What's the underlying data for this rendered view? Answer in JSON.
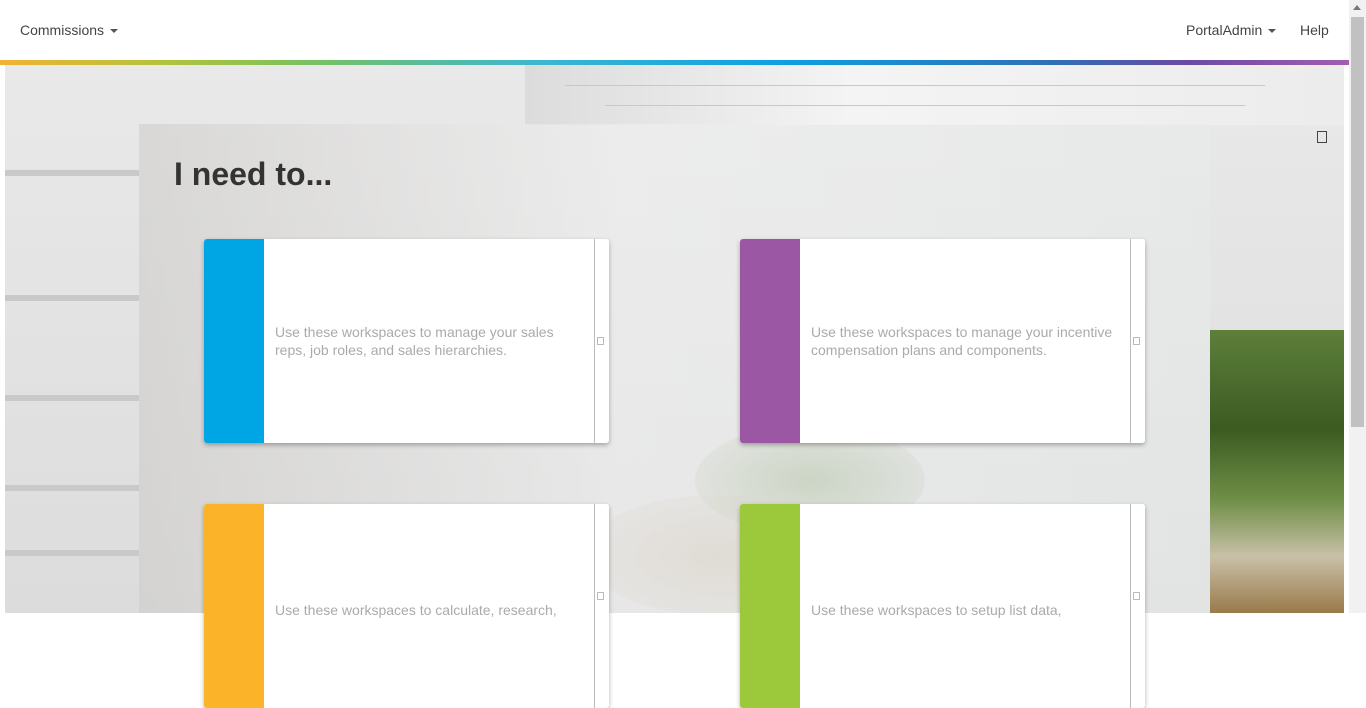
{
  "navbar": {
    "app_menu_label": "Commissions",
    "user_menu_label": "PortalAdmin",
    "help_label": "Help"
  },
  "main": {
    "heading": "I need to...",
    "cards": [
      {
        "color": "#00a6e4",
        "description": "Use these workspaces to manage your sales reps, job roles, and sales hierarchies."
      },
      {
        "color": "#9b57a4",
        "description": "Use these workspaces to manage your incentive compensation plans and components."
      },
      {
        "color": "#fbb429",
        "description": "Use these workspaces to calculate, research,"
      },
      {
        "color": "#9cc83b",
        "description": "Use these workspaces to setup list data,"
      }
    ]
  },
  "icons": {
    "corner": "square-outline-icon",
    "card_handle": "square-outline-icon",
    "caret": "caret-down-icon"
  }
}
